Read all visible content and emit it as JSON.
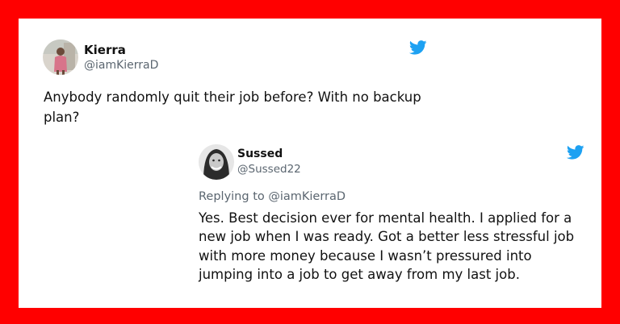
{
  "main_tweet": {
    "name": "Kierra",
    "handle": "@iamKierraD",
    "text": "Anybody randomly quit their job before? With no backup plan?",
    "avatar_icon": "person-photo-icon",
    "platform_icon": "twitter-bird-icon"
  },
  "reply_tweet": {
    "name": "Sussed",
    "handle": "@Sussed22",
    "replying_to": "Replying to @iamKierraD",
    "text": "Yes. Best decision ever for mental health. I applied for a new job when I was ready. Got a better less stressful job with more money because I wasn’t pressured into jumping into a job to get away from my last job.",
    "avatar_icon": "person-photo-icon",
    "platform_icon": "twitter-bird-icon"
  },
  "colors": {
    "frame": "#ff0000",
    "card": "#ffffff",
    "twitter_blue": "#1da1f2",
    "secondary_text": "#5b6670"
  }
}
